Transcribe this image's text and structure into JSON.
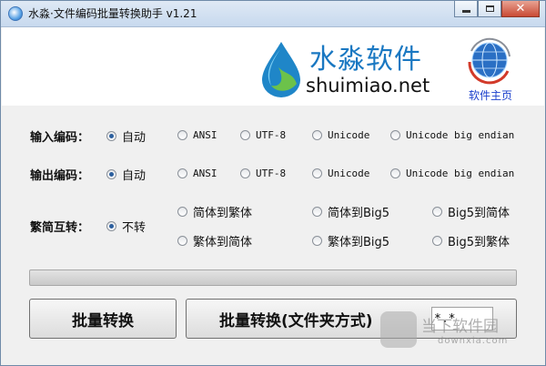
{
  "window": {
    "title": "水淼·文件编码批量转换助手 v1.21"
  },
  "banner": {
    "brand_name": "水淼软件",
    "brand_url": "shuimiao.net",
    "home_link": "软件主页"
  },
  "input_encoding": {
    "label": "输入编码：",
    "selected": "自动",
    "options": [
      "自动",
      "ANSI",
      "UTF-8",
      "Unicode",
      "Unicode big endian"
    ]
  },
  "output_encoding": {
    "label": "输出编码：",
    "selected": "自动",
    "options": [
      "自动",
      "ANSI",
      "UTF-8",
      "Unicode",
      "Unicode big endian"
    ]
  },
  "conversion": {
    "label": "繁简互转：",
    "selected": "不转",
    "options": [
      "不转",
      "简体到繁体",
      "简体到Big5",
      "Big5到简体",
      "繁体到简体",
      "繁体到Big5",
      "Big5到繁体"
    ]
  },
  "progress": {
    "value": 0
  },
  "buttons": {
    "batch_convert": "批量转换",
    "batch_convert_folder": "批量转换(文件夹方式)"
  },
  "filter": {
    "value": "*.*"
  },
  "watermark": {
    "text": "当下软件园",
    "sub": "downxia.com"
  }
}
